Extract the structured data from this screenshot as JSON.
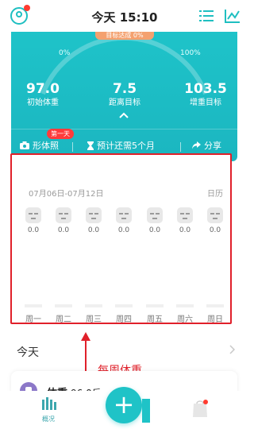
{
  "header": {
    "title": "今天 15:10"
  },
  "hero": {
    "top_pill": "目标达成 0%",
    "progress_start": "0%",
    "progress_end": "100%",
    "progress_fraction": 0,
    "stats": [
      {
        "value": "97.0",
        "label": "初始体重"
      },
      {
        "value": "7.5",
        "label": "距离目标"
      },
      {
        "value": "103.5",
        "label": "增重目标"
      }
    ],
    "tools": {
      "photo_label": "形体照",
      "photo_badge": "第一天",
      "estimate_label": "预计还需5个月",
      "share_label": "分享"
    }
  },
  "week": {
    "range": "07月06日-07月12日",
    "calendar_label": "日历",
    "days": [
      {
        "day": "周一",
        "value": "0.0"
      },
      {
        "day": "周二",
        "value": "0.0"
      },
      {
        "day": "周三",
        "value": "0.0"
      },
      {
        "day": "周四",
        "value": "0.0"
      },
      {
        "day": "周五",
        "value": "0.0"
      },
      {
        "day": "周六",
        "value": "0.0"
      },
      {
        "day": "周日",
        "value": "0.0"
      }
    ]
  },
  "today": {
    "label": "今天"
  },
  "annotation": {
    "text": "每周体重"
  },
  "weight_card": {
    "title": "体重",
    "value": "96.0斤"
  },
  "nav": {
    "home_label": "概况",
    "fab_symbol": "+"
  },
  "colors": {
    "accent": "#1fc3c7",
    "annotation": "#e0202a"
  }
}
